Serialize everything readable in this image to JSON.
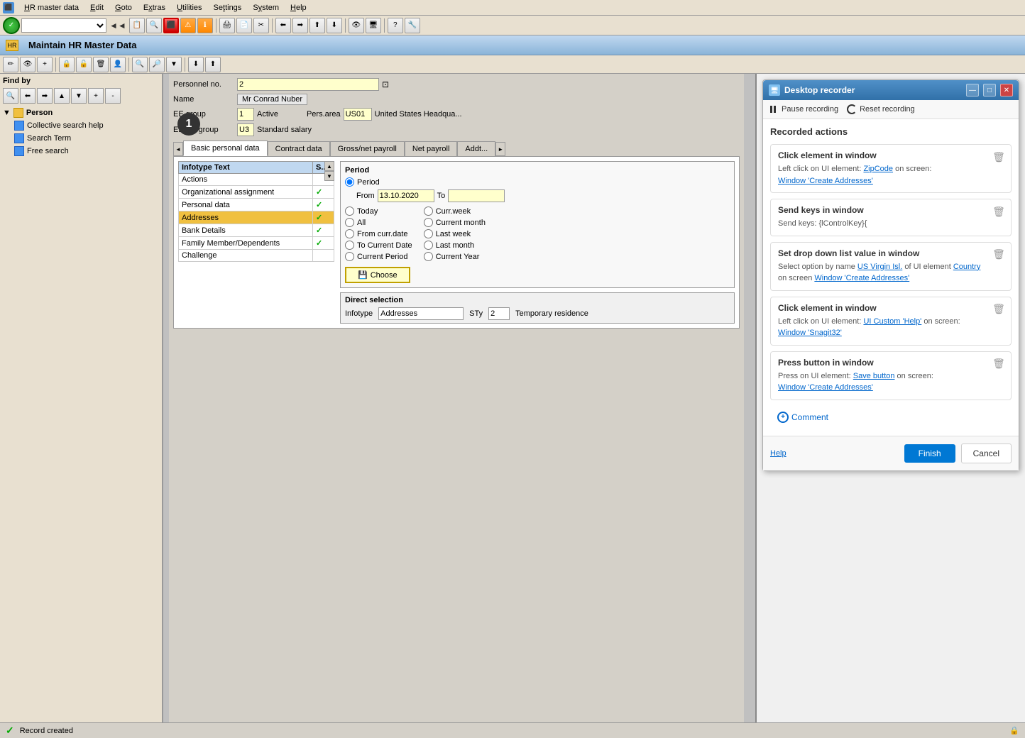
{
  "app": {
    "title": "Maintain HR Master Data",
    "badge_number": "1"
  },
  "menu": {
    "items": [
      {
        "label": "HR master data",
        "underline_index": 0
      },
      {
        "label": "Edit",
        "underline_index": 0
      },
      {
        "label": "Goto",
        "underline_index": 0
      },
      {
        "label": "Extras",
        "underline_index": 0
      },
      {
        "label": "Utilities",
        "underline_index": 0
      },
      {
        "label": "Settings",
        "underline_index": 0
      },
      {
        "label": "System",
        "underline_index": 0
      },
      {
        "label": "Help",
        "underline_index": 0
      }
    ]
  },
  "left_panel": {
    "find_by_label": "Find by",
    "tree": [
      {
        "label": "Person",
        "type": "folder",
        "indent": 0,
        "bold": true
      },
      {
        "label": "Collective search help",
        "type": "doc",
        "indent": 1
      },
      {
        "label": "Search Term",
        "type": "doc",
        "indent": 1
      },
      {
        "label": "Free search",
        "type": "doc",
        "indent": 1
      }
    ]
  },
  "form": {
    "personnel_no_label": "Personnel no.",
    "personnel_no_value": "2",
    "name_label": "Name",
    "name_value": "Mr  Conrad Nuber",
    "ee_group_label": "EE group",
    "ee_group_value": "1",
    "ee_group_status": "Active",
    "pers_area_label": "Pers.area",
    "pers_area_code": "US01",
    "pers_area_name": "United States Headqua...",
    "ee_subgroup_label": "EE subgroup",
    "ee_subgroup_value": "U3",
    "ee_subgroup_name": "Standard salary"
  },
  "tabs": [
    {
      "label": "Basic personal data",
      "active": true
    },
    {
      "label": "Contract data",
      "active": false
    },
    {
      "label": "Gross/net payroll",
      "active": false
    },
    {
      "label": "Net payroll",
      "active": false
    },
    {
      "label": "Addt...",
      "active": false
    }
  ],
  "infotype_table": {
    "headers": [
      "Infotype Text",
      "S..."
    ],
    "rows": [
      {
        "text": "Actions",
        "status": "",
        "selected": false
      },
      {
        "text": "Organizational assignment",
        "status": "✓",
        "selected": false
      },
      {
        "text": "Personal data",
        "status": "✓",
        "selected": false
      },
      {
        "text": "Addresses",
        "status": "✓",
        "selected": true
      },
      {
        "text": "Bank Details",
        "status": "✓",
        "selected": false
      },
      {
        "text": "Family Member/Dependents",
        "status": "✓",
        "selected": false
      },
      {
        "text": "Challenge",
        "status": "",
        "selected": false
      }
    ]
  },
  "period": {
    "title": "Period",
    "radio_options": [
      {
        "label": "Period",
        "name": "period",
        "checked": true
      },
      {
        "label": "Today",
        "name": "period"
      },
      {
        "label": "All",
        "name": "period"
      },
      {
        "label": "From curr.date",
        "name": "period"
      },
      {
        "label": "To Current Date",
        "name": "period"
      },
      {
        "label": "Current Period",
        "name": "period"
      },
      {
        "label": "Curr.week",
        "name": "period"
      },
      {
        "label": "Current month",
        "name": "period"
      },
      {
        "label": "Last week",
        "name": "period"
      },
      {
        "label": "Last month",
        "name": "period"
      },
      {
        "label": "Current Year",
        "name": "period"
      }
    ],
    "from_label": "From",
    "from_value": "13.10.2020",
    "to_label": "To",
    "to_value": "",
    "choose_label": "Choose"
  },
  "direct_selection": {
    "title": "Direct selection",
    "infotype_label": "Infotype",
    "infotype_value": "Addresses",
    "sty_label": "STy",
    "sty_value": "2",
    "sty_desc": "Temporary residence"
  },
  "status_bar": {
    "message": "Record created"
  },
  "recorder": {
    "title": "Desktop recorder",
    "pause_label": "Pause recording",
    "reset_label": "Reset recording",
    "recorded_actions_title": "Recorded actions",
    "actions": [
      {
        "title": "Click element in window",
        "desc_prefix": "Left click on UI element: ",
        "element_name": "ZipCode",
        "desc_mid": " on screen: ",
        "screen_name": "Window 'Create Addresses'"
      },
      {
        "title": "Send keys in window",
        "desc_prefix": "Send keys: ",
        "keys": "{lControlKey}{"
      },
      {
        "title": "Set drop down list value in window",
        "desc_prefix": "Select option by name ",
        "option_name": "US Virgin Isl.",
        "desc_mid": " of UI element ",
        "element_name": "Country",
        "desc_suffix": " on screen ",
        "screen_name": "Window 'Create Addresses'"
      },
      {
        "title": "Click element in window",
        "desc_prefix": "Left click on UI element: ",
        "element_name": "UI Custom 'Help'",
        "desc_mid": " on screen: ",
        "screen_name": "Window 'Snagit32'"
      },
      {
        "title": "Press button in window",
        "desc_prefix": "Press on UI element: ",
        "element_name": "Save button",
        "desc_mid": " on screen: ",
        "screen_name": "Window 'Create Addresses'"
      }
    ],
    "comment_label": "Comment",
    "help_label": "Help",
    "finish_label": "Finish",
    "cancel_label": "Cancel"
  }
}
